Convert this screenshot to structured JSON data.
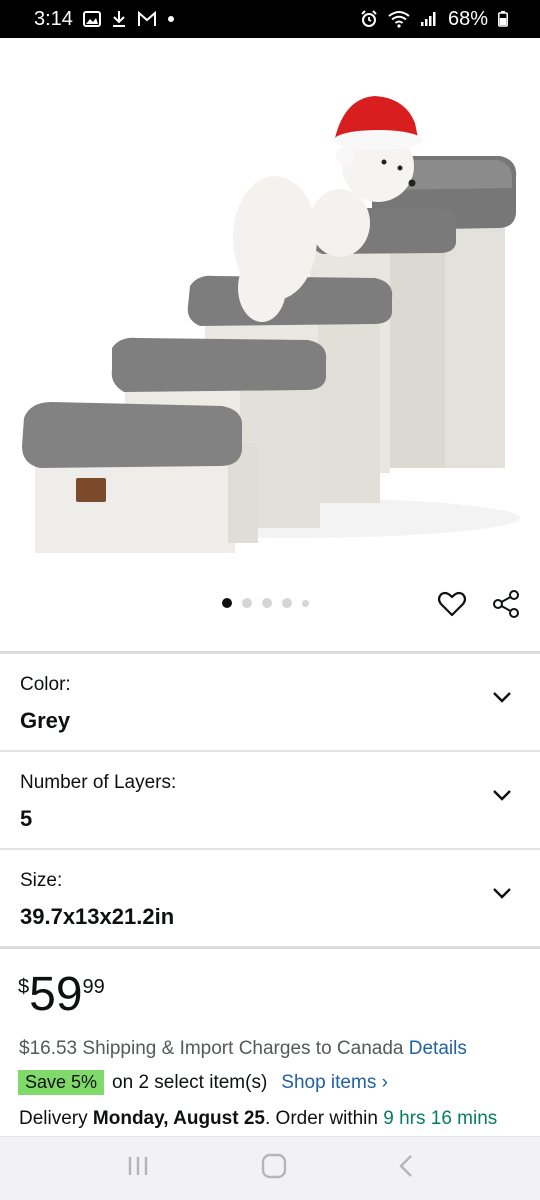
{
  "status_bar": {
    "time": "3:14",
    "battery": "68%"
  },
  "gallery": {
    "image_count": 5,
    "active_index": 0
  },
  "variants": [
    {
      "label": "Color:",
      "value": "Grey"
    },
    {
      "label": "Number of Layers:",
      "value": "5"
    },
    {
      "label": "Size:",
      "value": "39.7x13x21.2in"
    }
  ],
  "price": {
    "symbol": "$",
    "whole": "59",
    "fraction": "99"
  },
  "shipping": {
    "text": "$16.53 Shipping & Import Charges to Canada",
    "details_link": "Details"
  },
  "promo": {
    "badge": "Save 5%",
    "text": "on 2 select item(s)",
    "link": "Shop items ›"
  },
  "delivery": {
    "prefix": "Delivery",
    "date": "Monday, August 25",
    "middle": ". Order within",
    "countdown": "9 hrs 16 mins"
  },
  "colors": {
    "link": "#2162a1",
    "save_badge": "#7fda69",
    "countdown": "#067d62"
  }
}
